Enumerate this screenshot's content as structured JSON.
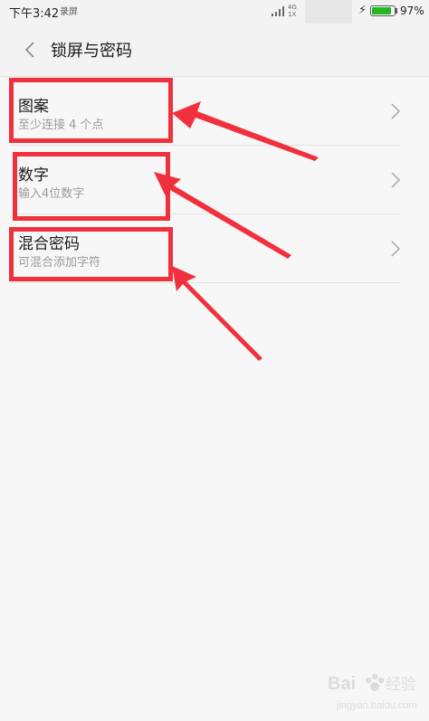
{
  "status_bar": {
    "time": "下午3:42",
    "notification_text": "录屏",
    "network_type_top": "4G",
    "network_type_bottom": "1X",
    "battery_percent": 97,
    "battery_text": "97%",
    "battery_color": "#21b820"
  },
  "header": {
    "back_icon": "chevron-left-icon",
    "title": "锁屏与密码"
  },
  "options": [
    {
      "title": "图案",
      "subtitle": "至少连接 4 个点",
      "icon": "chevron-right-icon"
    },
    {
      "title": "数字",
      "subtitle": "输入4位数字",
      "icon": "chevron-right-icon"
    },
    {
      "title": "混合密码",
      "subtitle": "可混合添加字符",
      "icon": "chevron-right-icon"
    }
  ],
  "annotations": {
    "highlight_color": "#f0313d"
  },
  "watermark": {
    "brand": "Bai",
    "brand_suffix": "经验",
    "url": "jingyan.baidu.com"
  }
}
